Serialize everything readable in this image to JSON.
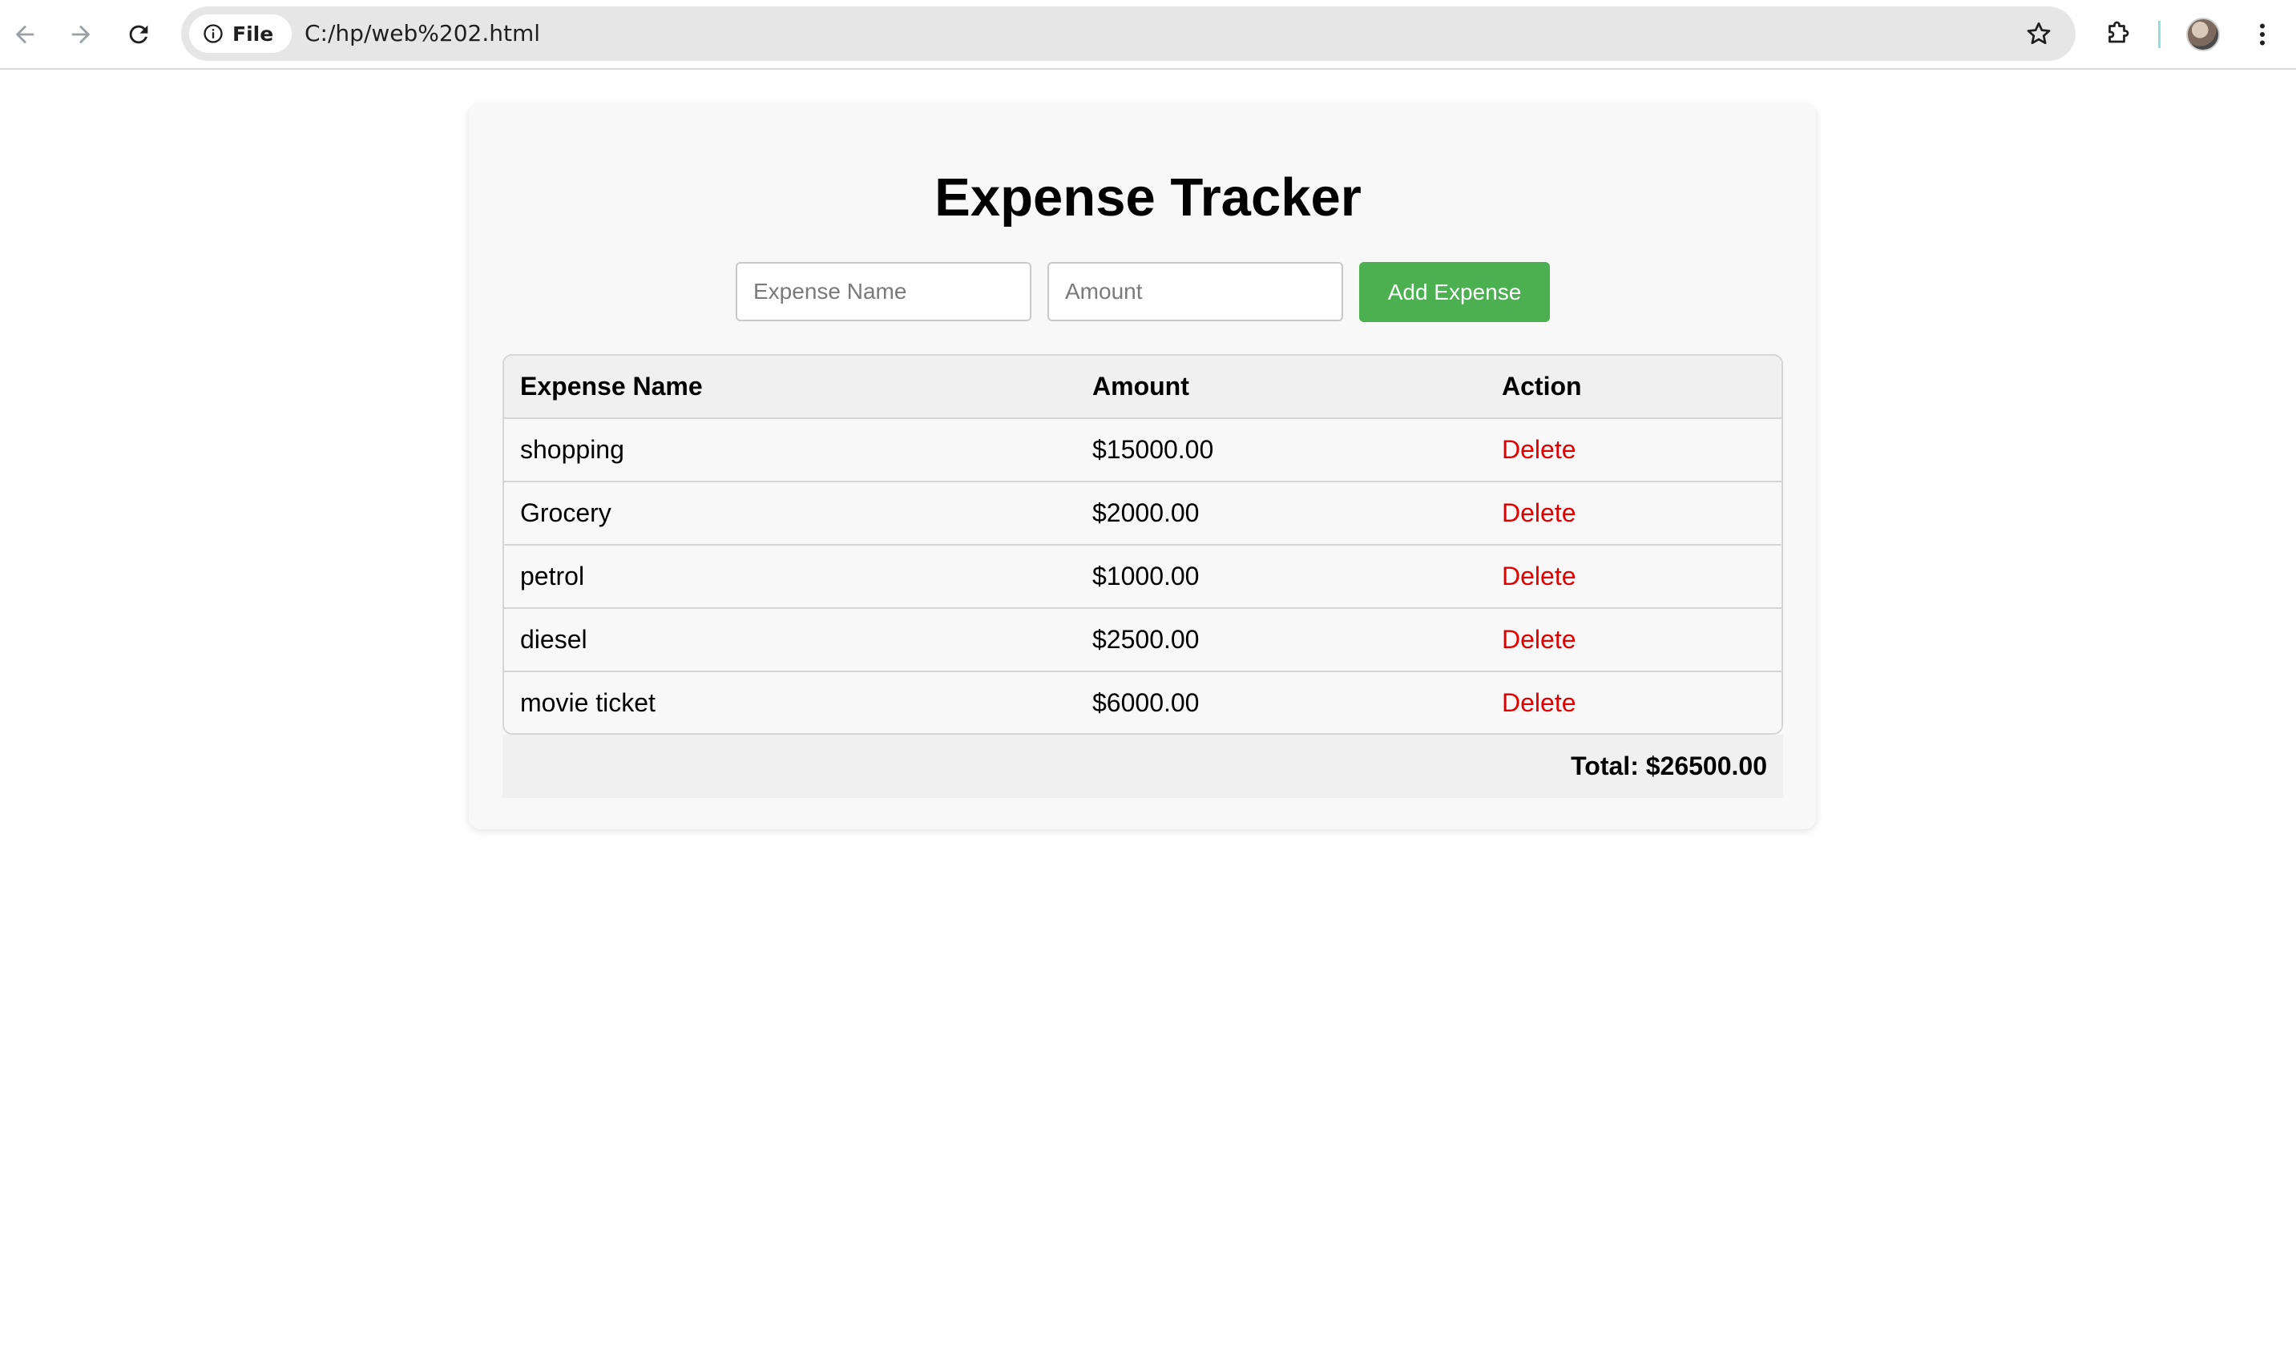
{
  "browser": {
    "chip_label": "File",
    "url": "C:/hp/web%202.html"
  },
  "page": {
    "title": "Expense Tracker",
    "form": {
      "name_placeholder": "Expense Name",
      "amount_placeholder": "Amount",
      "add_button": "Add Expense"
    },
    "table": {
      "headers": [
        "Expense Name",
        "Amount",
        "Action"
      ],
      "rows": [
        {
          "name": "shopping",
          "amount": "$15000.00",
          "action": "Delete"
        },
        {
          "name": "Grocery",
          "amount": "$2000.00",
          "action": "Delete"
        },
        {
          "name": "petrol",
          "amount": "$1000.00",
          "action": "Delete"
        },
        {
          "name": "diesel",
          "amount": "$2500.00",
          "action": "Delete"
        },
        {
          "name": "movie ticket",
          "amount": "$6000.00",
          "action": "Delete"
        }
      ]
    },
    "total": "Total: $26500.00"
  },
  "colors": {
    "add_button": "#4caf50",
    "delete_link": "#e00000"
  }
}
